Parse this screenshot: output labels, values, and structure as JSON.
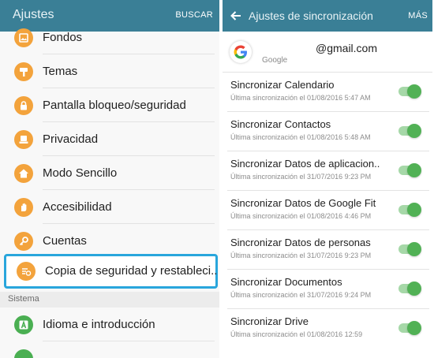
{
  "left": {
    "title": "Ajustes",
    "action": "BUSCAR",
    "items": [
      {
        "label": "Fondos",
        "icon": "wallpaper-icon"
      },
      {
        "label": "Temas",
        "icon": "brush-icon"
      },
      {
        "label": "Pantalla bloqueo/seguridad",
        "icon": "lock-icon"
      },
      {
        "label": "Privacidad",
        "icon": "privacy-icon"
      },
      {
        "label": "Modo Sencillo",
        "icon": "home-icon"
      },
      {
        "label": "Accesibilidad",
        "icon": "hand-icon"
      },
      {
        "label": "Cuentas",
        "icon": "key-icon"
      },
      {
        "label": "Copia de seguridad y restableci..",
        "icon": "backup-icon"
      }
    ],
    "section": "Sistema",
    "system_items": [
      {
        "label": "Idioma e introducción",
        "icon": "language-icon"
      }
    ]
  },
  "right": {
    "title": "Ajustes de sincronización",
    "action": "MÁS",
    "account": {
      "email": "@gmail.com",
      "type": "Google",
      "icon": "google-icon"
    },
    "sync_items": [
      {
        "title": "Sincronizar Calendario",
        "date": "Última sincronización el 01/08/2016 5:47 AM",
        "enabled": true
      },
      {
        "title": "Sincronizar Contactos",
        "date": "Última sincronización el 01/08/2016 5:48 AM",
        "enabled": true
      },
      {
        "title": "Sincronizar Datos de aplicacion..",
        "date": "Última sincronización el 31/07/2016 9:23 PM",
        "enabled": true
      },
      {
        "title": "Sincronizar Datos de Google Fit",
        "date": "Última sincronización el 01/08/2016 4:46 PM",
        "enabled": true
      },
      {
        "title": "Sincronizar Datos de personas",
        "date": "Última sincronización el 31/07/2016 9:23 PM",
        "enabled": true
      },
      {
        "title": "Sincronizar Documentos",
        "date": "Última sincronización el 31/07/2016 9:24 PM",
        "enabled": true
      },
      {
        "title": "Sincronizar Drive",
        "date": "Última sincronización el 01/08/2016 12:59",
        "enabled": true
      }
    ]
  },
  "colors": {
    "header": "#3a7f96",
    "icon_orange": "#f3a33c",
    "icon_green": "#4aaf52",
    "toggle_on": "#51b155",
    "highlight": "#29a6dc"
  }
}
